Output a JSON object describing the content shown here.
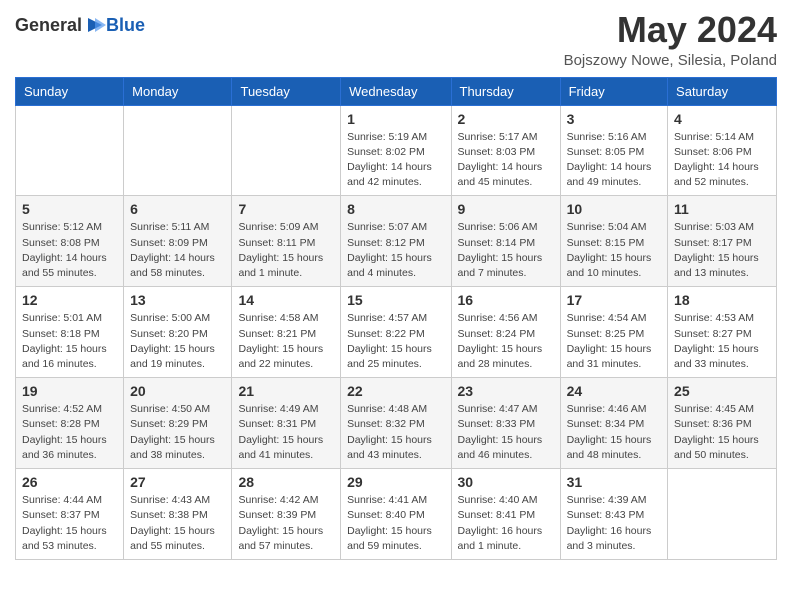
{
  "logo": {
    "text_general": "General",
    "text_blue": "Blue",
    "icon": "▶"
  },
  "title": "May 2024",
  "subtitle": "Bojszowy Nowe, Silesia, Poland",
  "days_of_week": [
    "Sunday",
    "Monday",
    "Tuesday",
    "Wednesday",
    "Thursday",
    "Friday",
    "Saturday"
  ],
  "weeks": [
    [
      {
        "day": "",
        "info": ""
      },
      {
        "day": "",
        "info": ""
      },
      {
        "day": "",
        "info": ""
      },
      {
        "day": "1",
        "info": "Sunrise: 5:19 AM\nSunset: 8:02 PM\nDaylight: 14 hours\nand 42 minutes."
      },
      {
        "day": "2",
        "info": "Sunrise: 5:17 AM\nSunset: 8:03 PM\nDaylight: 14 hours\nand 45 minutes."
      },
      {
        "day": "3",
        "info": "Sunrise: 5:16 AM\nSunset: 8:05 PM\nDaylight: 14 hours\nand 49 minutes."
      },
      {
        "day": "4",
        "info": "Sunrise: 5:14 AM\nSunset: 8:06 PM\nDaylight: 14 hours\nand 52 minutes."
      }
    ],
    [
      {
        "day": "5",
        "info": "Sunrise: 5:12 AM\nSunset: 8:08 PM\nDaylight: 14 hours\nand 55 minutes."
      },
      {
        "day": "6",
        "info": "Sunrise: 5:11 AM\nSunset: 8:09 PM\nDaylight: 14 hours\nand 58 minutes."
      },
      {
        "day": "7",
        "info": "Sunrise: 5:09 AM\nSunset: 8:11 PM\nDaylight: 15 hours\nand 1 minute."
      },
      {
        "day": "8",
        "info": "Sunrise: 5:07 AM\nSunset: 8:12 PM\nDaylight: 15 hours\nand 4 minutes."
      },
      {
        "day": "9",
        "info": "Sunrise: 5:06 AM\nSunset: 8:14 PM\nDaylight: 15 hours\nand 7 minutes."
      },
      {
        "day": "10",
        "info": "Sunrise: 5:04 AM\nSunset: 8:15 PM\nDaylight: 15 hours\nand 10 minutes."
      },
      {
        "day": "11",
        "info": "Sunrise: 5:03 AM\nSunset: 8:17 PM\nDaylight: 15 hours\nand 13 minutes."
      }
    ],
    [
      {
        "day": "12",
        "info": "Sunrise: 5:01 AM\nSunset: 8:18 PM\nDaylight: 15 hours\nand 16 minutes."
      },
      {
        "day": "13",
        "info": "Sunrise: 5:00 AM\nSunset: 8:20 PM\nDaylight: 15 hours\nand 19 minutes."
      },
      {
        "day": "14",
        "info": "Sunrise: 4:58 AM\nSunset: 8:21 PM\nDaylight: 15 hours\nand 22 minutes."
      },
      {
        "day": "15",
        "info": "Sunrise: 4:57 AM\nSunset: 8:22 PM\nDaylight: 15 hours\nand 25 minutes."
      },
      {
        "day": "16",
        "info": "Sunrise: 4:56 AM\nSunset: 8:24 PM\nDaylight: 15 hours\nand 28 minutes."
      },
      {
        "day": "17",
        "info": "Sunrise: 4:54 AM\nSunset: 8:25 PM\nDaylight: 15 hours\nand 31 minutes."
      },
      {
        "day": "18",
        "info": "Sunrise: 4:53 AM\nSunset: 8:27 PM\nDaylight: 15 hours\nand 33 minutes."
      }
    ],
    [
      {
        "day": "19",
        "info": "Sunrise: 4:52 AM\nSunset: 8:28 PM\nDaylight: 15 hours\nand 36 minutes."
      },
      {
        "day": "20",
        "info": "Sunrise: 4:50 AM\nSunset: 8:29 PM\nDaylight: 15 hours\nand 38 minutes."
      },
      {
        "day": "21",
        "info": "Sunrise: 4:49 AM\nSunset: 8:31 PM\nDaylight: 15 hours\nand 41 minutes."
      },
      {
        "day": "22",
        "info": "Sunrise: 4:48 AM\nSunset: 8:32 PM\nDaylight: 15 hours\nand 43 minutes."
      },
      {
        "day": "23",
        "info": "Sunrise: 4:47 AM\nSunset: 8:33 PM\nDaylight: 15 hours\nand 46 minutes."
      },
      {
        "day": "24",
        "info": "Sunrise: 4:46 AM\nSunset: 8:34 PM\nDaylight: 15 hours\nand 48 minutes."
      },
      {
        "day": "25",
        "info": "Sunrise: 4:45 AM\nSunset: 8:36 PM\nDaylight: 15 hours\nand 50 minutes."
      }
    ],
    [
      {
        "day": "26",
        "info": "Sunrise: 4:44 AM\nSunset: 8:37 PM\nDaylight: 15 hours\nand 53 minutes."
      },
      {
        "day": "27",
        "info": "Sunrise: 4:43 AM\nSunset: 8:38 PM\nDaylight: 15 hours\nand 55 minutes."
      },
      {
        "day": "28",
        "info": "Sunrise: 4:42 AM\nSunset: 8:39 PM\nDaylight: 15 hours\nand 57 minutes."
      },
      {
        "day": "29",
        "info": "Sunrise: 4:41 AM\nSunset: 8:40 PM\nDaylight: 15 hours\nand 59 minutes."
      },
      {
        "day": "30",
        "info": "Sunrise: 4:40 AM\nSunset: 8:41 PM\nDaylight: 16 hours\nand 1 minute."
      },
      {
        "day": "31",
        "info": "Sunrise: 4:39 AM\nSunset: 8:43 PM\nDaylight: 16 hours\nand 3 minutes."
      },
      {
        "day": "",
        "info": ""
      }
    ]
  ]
}
